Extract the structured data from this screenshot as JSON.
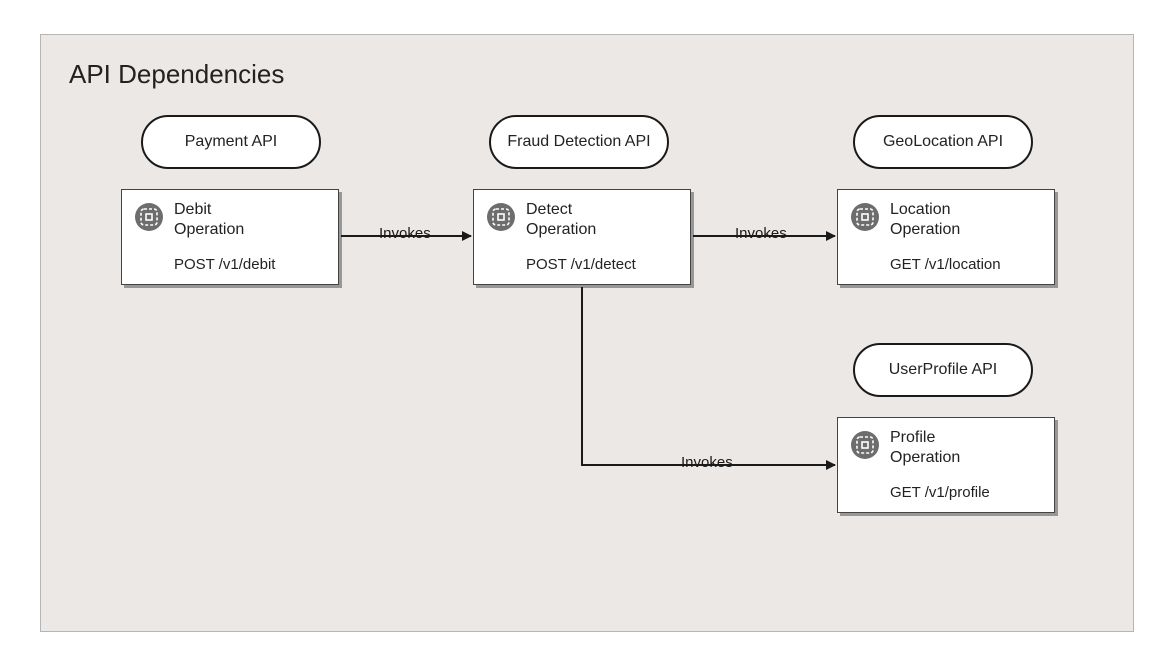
{
  "title": "API Dependencies",
  "apis": {
    "payment": {
      "label": "Payment API"
    },
    "fraud": {
      "label": "Fraud Detection API"
    },
    "geo": {
      "label": "GeoLocation API"
    },
    "profile": {
      "label": "UserProfile API"
    }
  },
  "operations": {
    "debit": {
      "name_line1": "Debit",
      "name_line2": "Operation",
      "path": "POST /v1/debit"
    },
    "detect": {
      "name_line1": "Detect",
      "name_line2": "Operation",
      "path": "POST /v1/detect"
    },
    "location": {
      "name_line1": "Location",
      "name_line2": "Operation",
      "path": "GET /v1/location"
    },
    "profile": {
      "name_line1": "Profile",
      "name_line2": "Operation",
      "path": "GET /v1/profile"
    }
  },
  "edges": {
    "e1": {
      "label": "Invokes"
    },
    "e2": {
      "label": "Invokes"
    },
    "e3": {
      "label": "Invokes"
    }
  }
}
